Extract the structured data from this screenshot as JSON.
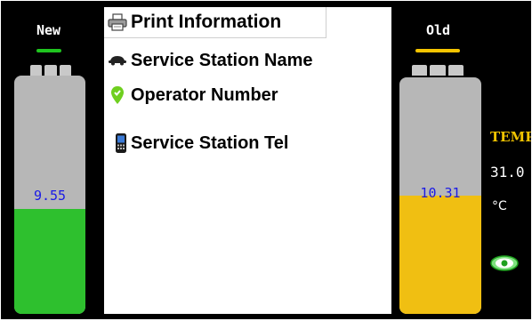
{
  "new_tank": {
    "label": "New",
    "value": "9.55",
    "fill_fraction": 0.44,
    "indicator_color": "#1fc41f",
    "fill_color": "#2ec02e"
  },
  "old_tank": {
    "label": "Old",
    "value": "10.31",
    "fill_fraction": 0.5,
    "indicator_color": "#f5c400",
    "fill_color": "#f0bf12"
  },
  "menu": {
    "title": "Print Information",
    "title_icon": "printer-icon",
    "items": [
      {
        "label": "Service Station Name",
        "icon": "car-icon"
      },
      {
        "label": "Operator Number",
        "icon": "location-pin-icon"
      },
      {
        "label": "Service Station Tel",
        "icon": "mobile-phone-icon"
      }
    ]
  },
  "temperature": {
    "label": "TEMP",
    "value": "31.0",
    "unit": "°C"
  },
  "status_icon": "eye-icon",
  "colors": {
    "background": "#000000",
    "panel": "#ffffff",
    "value_text": "#1a1ae6",
    "temp_label": "#f2c400",
    "icon_green": "#6fcf1f"
  }
}
